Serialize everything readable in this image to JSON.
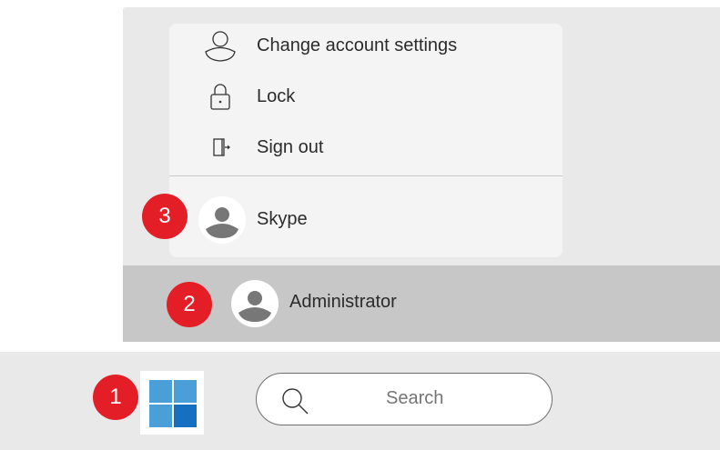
{
  "account_menu": {
    "items": [
      {
        "label": "Change account settings",
        "icon": "person-outline-icon"
      },
      {
        "label": "Lock",
        "icon": "padlock-icon"
      },
      {
        "label": "Sign out",
        "icon": "sign-out-icon"
      }
    ],
    "other_account": {
      "label": "Skype",
      "icon": "user-avatar-icon"
    }
  },
  "user_bar": {
    "username": "Administrator",
    "icon": "user-avatar-icon"
  },
  "taskbar": {
    "start_icon": "windows-logo-icon",
    "search": {
      "placeholder": "Search",
      "icon": "search-icon"
    }
  },
  "step_badges": [
    "1",
    "2",
    "3"
  ],
  "colors": {
    "badge": "#e41e26",
    "panel": "#e9e9e9",
    "menu": "#f4f4f4",
    "user_bar": "#c7c7c7",
    "windows_blue_light": "#4a9fd8",
    "windows_blue_dark": "#1670c2"
  }
}
